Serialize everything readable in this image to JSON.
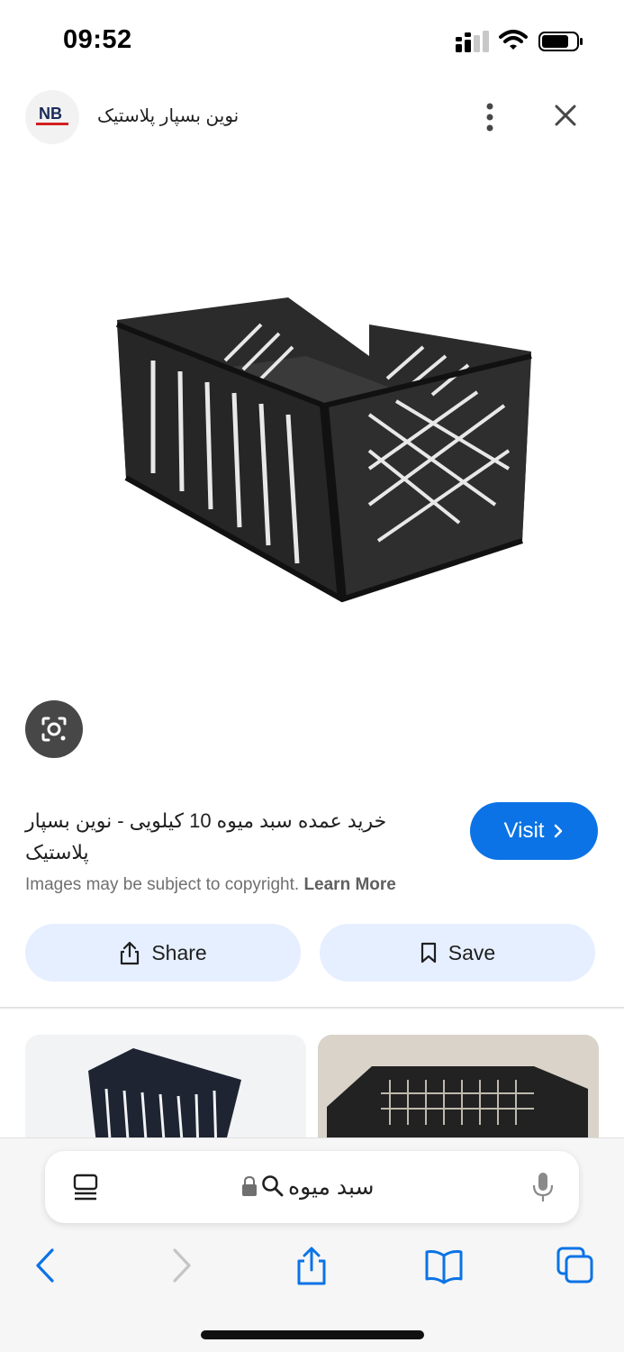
{
  "status_bar": {
    "time": "09:52",
    "icons": [
      "signal-icon",
      "wifi-icon",
      "battery-icon"
    ]
  },
  "source": {
    "logo_text": "NB",
    "name": "نوین بسپار پلاستیک",
    "more_icon": "more-vert-icon",
    "close_icon": "close-icon"
  },
  "result": {
    "image_subject": "black plastic fruit crate",
    "lens_icon": "google-lens-icon",
    "title": "خرید عمده سبد میوه 10 کیلویی - نوین بسپار پلاستیک",
    "visit_label": "Visit",
    "copyright_text": "Images may be subject to copyright.",
    "learn_more_label": "Learn More",
    "share_label": "Share",
    "save_label": "Save"
  },
  "related": {
    "thumbnails": [
      "crate-thumbnail-1",
      "crate-thumbnail-2"
    ]
  },
  "browser": {
    "address_text": "سبد میوه",
    "toolbar_icons": [
      "back-icon",
      "forward-icon",
      "share-icon",
      "bookmarks-icon",
      "tabs-icon"
    ],
    "accent_color": "#0b73e5"
  }
}
